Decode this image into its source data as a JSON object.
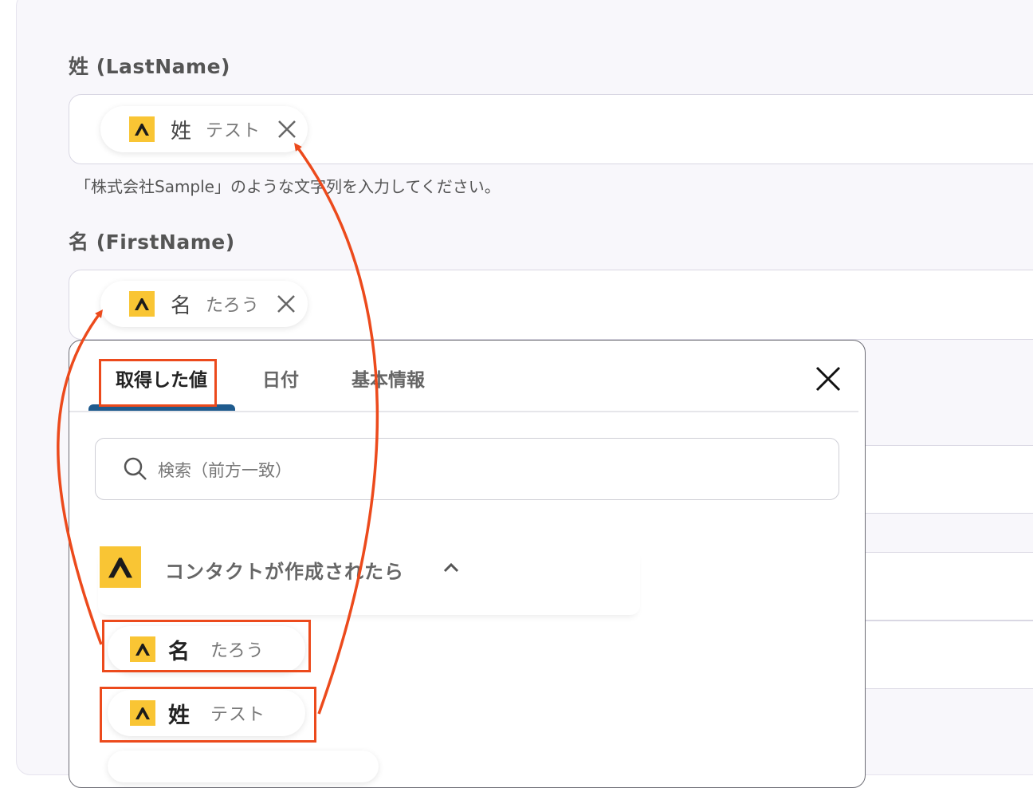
{
  "fields": [
    {
      "label": "姓 (LastName)",
      "chip_key": "姓",
      "chip_value": "テスト"
    },
    {
      "label": "名 (FirstName)",
      "chip_key": "名",
      "chip_value": "たろう"
    }
  ],
  "hint_text": "「株式会社Sample」のような文字列を入力してください。",
  "popup": {
    "tabs": [
      "取得した値",
      "日付",
      "基本情報"
    ],
    "active_tab": "取得した値",
    "search_placeholder": "検索（前方一致）",
    "section_title": "コンタクトが作成されたら",
    "items": [
      {
        "key": "名",
        "value": "たろう"
      },
      {
        "key": "姓",
        "value": "テスト"
      }
    ]
  },
  "colors": {
    "accent": "#ec4a1c",
    "logo_bg": "#f9c534",
    "tab_indicator": "#1f5b8e"
  },
  "icons": [
    "app-logo-icon",
    "close-icon",
    "search-icon",
    "chevron-up-icon"
  ]
}
